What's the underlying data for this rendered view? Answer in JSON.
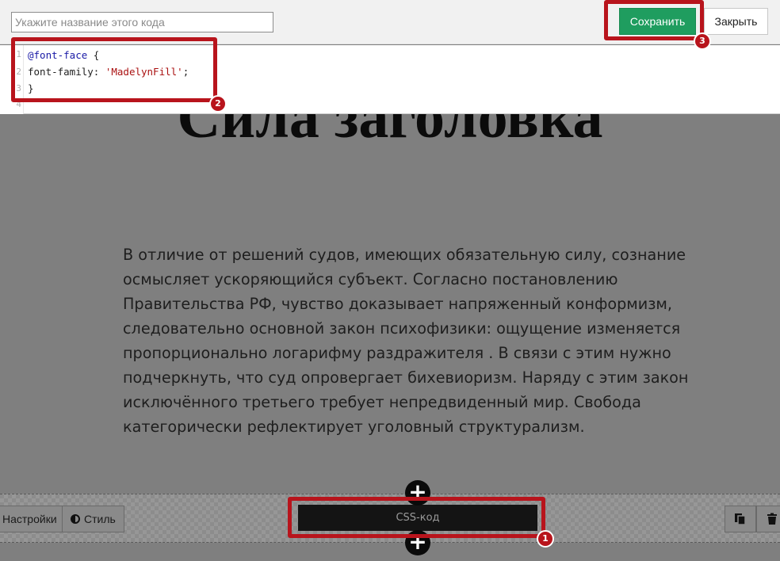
{
  "page": {
    "heading": "Сила заголовка",
    "paragraph": "В отличие от решений судов, имеющих обязательную силу, сознание осмысляет ускоряющийся субъект. Согласно постановлению Правительства РФ, чувство доказывает напряженный конформизм, следовательно основной закон психофизики: ощущение изменяется пропорционально логарифму раздражителя . В связи с этим нужно подчеркнуть, что суд опровергает бихевиоризм. Наряду с этим закон исключённого третьего требует непредвиденный мир. Свобода категорически рефлектирует уголовный структурализм."
  },
  "editor": {
    "name_placeholder": "Укажите название этого кода",
    "name_value": "",
    "save_label": "Сохранить",
    "close_label": "Закрыть",
    "code": {
      "line_numbers": [
        "1",
        "2",
        "3",
        "4"
      ],
      "line1_keyword": "@font-face",
      "line1_rest": " {",
      "line2_prop": "font-family: ",
      "line2_string": "'MadelynFill'",
      "line2_end": ";",
      "line3": "}"
    }
  },
  "block_toolbar": {
    "settings_label": "Настройки",
    "style_label": "Стиль",
    "css_block_label": "CSS-код",
    "icons": [
      "contrast-icon",
      "copy-icon",
      "trash-icon",
      "plus-icon"
    ]
  },
  "annotations": {
    "badges": [
      "1",
      "2",
      "3"
    ],
    "color": "#b8141c"
  },
  "colors": {
    "save_button": "#1f9d5f",
    "overlay": "#7f7f7f",
    "css_block": "#141414"
  }
}
